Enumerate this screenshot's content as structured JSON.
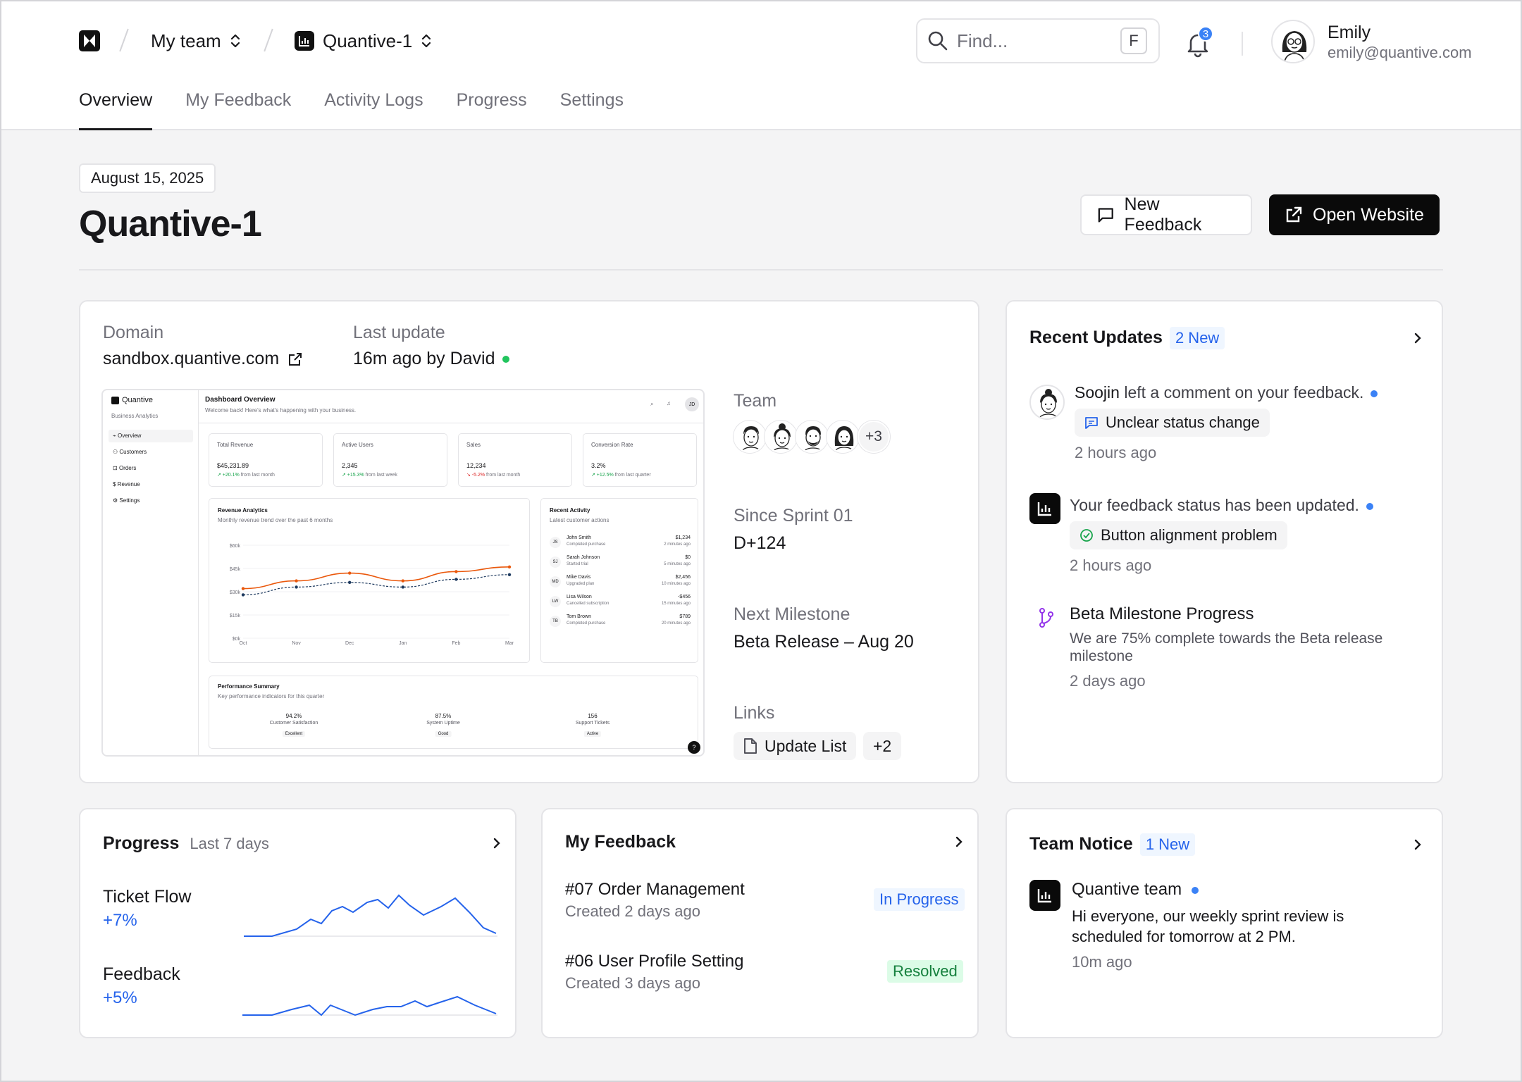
{
  "header": {
    "team": "My team",
    "project": "Quantive-1",
    "search_placeholder": "Find...",
    "search_shortcut": "F",
    "notifications_count": "3",
    "user_name": "Emily",
    "user_email": "emily@quantive.com"
  },
  "tabs": [
    "Overview",
    "My Feedback",
    "Activity Logs",
    "Progress",
    "Settings"
  ],
  "page": {
    "date": "August 15, 2025",
    "title": "Quantive-1",
    "new_feedback": "New Feedback",
    "open_website": "Open Website"
  },
  "overview": {
    "domain_label": "Domain",
    "domain": "sandbox.quantive.com",
    "last_update_label": "Last update",
    "last_update": "16m ago by David",
    "team_label": "Team",
    "team_more": "+3",
    "since_label": "Since Sprint 01",
    "since_value": "D+124",
    "milestone_label": "Next Milestone",
    "milestone_value": "Beta Release – Aug 20",
    "links_label": "Links",
    "link_name": "Update List",
    "links_more": "+2"
  },
  "preview": {
    "brand": "Quantive",
    "brand_sub": "Business Analytics",
    "nav": [
      "Overview",
      "Customers",
      "Orders",
      "Revenue",
      "Settings"
    ],
    "title": "Dashboard Overview",
    "subtitle": "Welcome back! Here's what's happening with your business.",
    "avatar": "JD",
    "kpis": [
      {
        "label": "Total Revenue",
        "value": "$45,231.89",
        "delta": "+20.1%",
        "note": "from last month",
        "up": true
      },
      {
        "label": "Active Users",
        "value": "2,345",
        "delta": "+15.3%",
        "note": "from last week",
        "up": true
      },
      {
        "label": "Sales",
        "value": "12,234",
        "delta": "-5.2%",
        "note": "from last month",
        "up": false
      },
      {
        "label": "Conversion Rate",
        "value": "3.2%",
        "delta": "+12.5%",
        "note": "from last quarter",
        "up": true
      }
    ],
    "revenue_title": "Revenue Analytics",
    "revenue_sub": "Monthly revenue trend over the past 6 months",
    "y_ticks": [
      "$60k",
      "$45k",
      "$30k",
      "$15k",
      "$0k"
    ],
    "x_ticks": [
      "Oct",
      "Nov",
      "Dec",
      "Jan",
      "Feb",
      "Mar"
    ],
    "activity_title": "Recent Activity",
    "activity_sub": "Latest customer actions",
    "activity": [
      {
        "initials": "JS",
        "name": "John Smith",
        "action": "Completed purchase",
        "amount": "$1,234",
        "time": "2 minutes ago"
      },
      {
        "initials": "SJ",
        "name": "Sarah Johnson",
        "action": "Started trial",
        "amount": "$0",
        "time": "5 minutes ago"
      },
      {
        "initials": "MD",
        "name": "Mike Davis",
        "action": "Upgraded plan",
        "amount": "$2,456",
        "time": "10 minutes ago"
      },
      {
        "initials": "LW",
        "name": "Lisa Wilson",
        "action": "Cancelled subscription",
        "amount": "-$456",
        "time": "15 minutes ago"
      },
      {
        "initials": "TB",
        "name": "Tom Brown",
        "action": "Completed purchase",
        "amount": "$789",
        "time": "20 minutes ago"
      }
    ],
    "perf_title": "Performance Summary",
    "perf_sub": "Key performance indicators for this quarter",
    "perf": [
      {
        "value": "94.2%",
        "label": "Customer Satisfaction",
        "badge": "Excellent"
      },
      {
        "value": "87.5%",
        "label": "System Uptime",
        "badge": "Good"
      },
      {
        "value": "156",
        "label": "Support Tickets",
        "badge": "Active"
      }
    ],
    "help": "?"
  },
  "chart_data": {
    "type": "line",
    "x": [
      "Oct",
      "Nov",
      "Dec",
      "Jan",
      "Feb",
      "Mar"
    ],
    "ylim": [
      0,
      60
    ],
    "series": [
      {
        "values": [
          32,
          37,
          42,
          37,
          43,
          46
        ],
        "color": "#ea580c"
      },
      {
        "values": [
          28,
          33,
          36,
          33,
          38,
          41
        ],
        "color": "#1e3a5f"
      }
    ]
  },
  "recent_updates": {
    "title": "Recent Updates",
    "badge": "2 New",
    "items": [
      {
        "actor": "Soojin",
        "text": "left a comment on your feedback.",
        "tag": "Unclear status change",
        "time": "2 hours ago"
      },
      {
        "text": "Your feedback status has been updated.",
        "tag": "Button alignment problem",
        "time": "2 hours ago"
      },
      {
        "title": "Beta Milestone Progress",
        "desc": "We are 75% complete towards the Beta release milestone",
        "time": "2 days ago"
      }
    ]
  },
  "progress": {
    "title": "Progress",
    "period": "Last 7 days",
    "rows": [
      {
        "label": "Ticket Flow",
        "delta": "+7%"
      },
      {
        "label": "Feedback",
        "delta": "+5%"
      }
    ],
    "accent": "#2563eb"
  },
  "my_feedback": {
    "title": "My Feedback",
    "items": [
      {
        "title": "#07 Order Management",
        "created": "Created 2 days ago",
        "status": "In Progress"
      },
      {
        "title": "#06 User Profile Setting",
        "created": "Created 3 days ago",
        "status": "Resolved"
      }
    ]
  },
  "team_notice": {
    "title": "Team Notice",
    "badge": "1 New",
    "author": "Quantive team",
    "message": "Hi everyone, our weekly sprint review is scheduled for tomorrow at 2 PM.",
    "time": "10m ago"
  }
}
